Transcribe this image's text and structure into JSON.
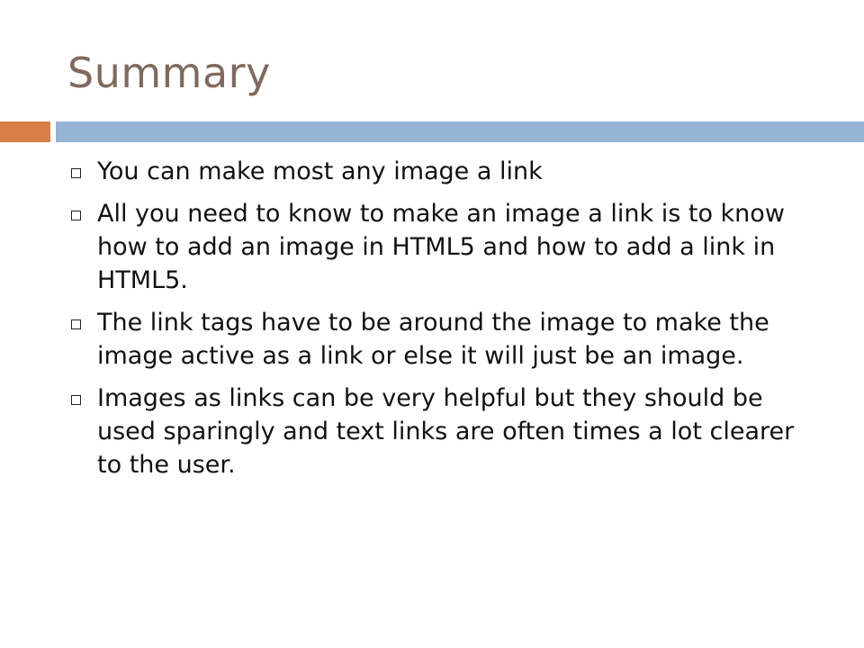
{
  "slide": {
    "title": "Summary",
    "accent_color": "#d97f47",
    "bar_color": "#95b4d4",
    "title_color": "#7f6a5d",
    "bullet_icon": "hollow-square-icon",
    "bullets": [
      "You can make most any image a link",
      "All you need to know to make an image a link is to know how to add an image in HTML5 and how to add a link in HTML5.",
      "The link tags have to be around the image to make the image active as a link or else it will just be an image.",
      "Images as links can be very helpful but they should be used sparingly and text links are often times a lot clearer to the user."
    ]
  }
}
